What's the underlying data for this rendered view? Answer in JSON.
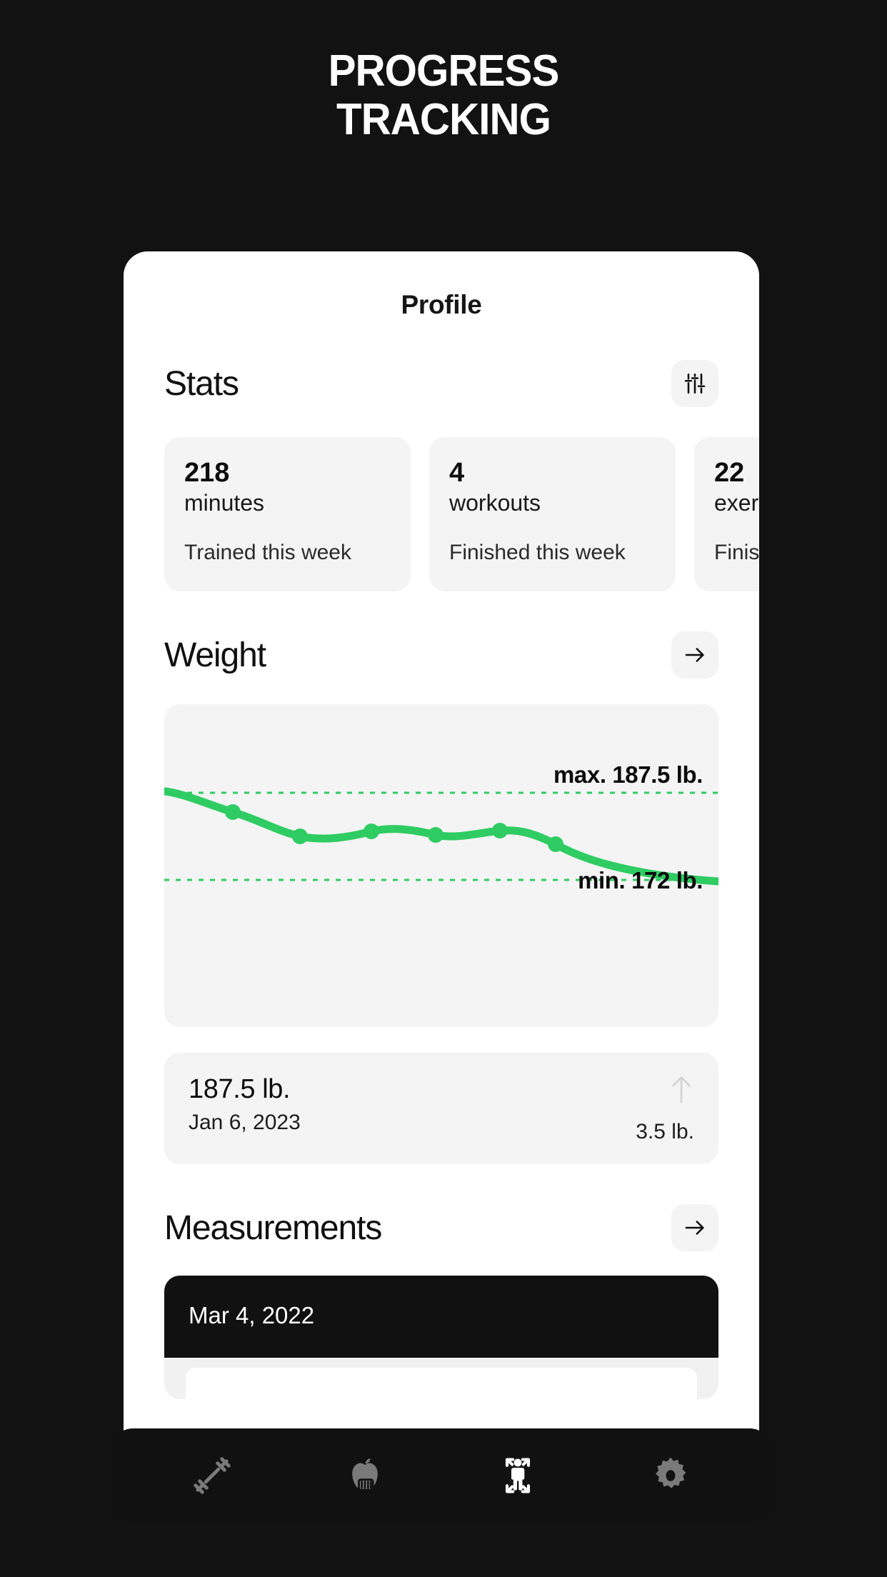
{
  "hero": {
    "line1": "PROGRESS",
    "line2": "TRACKING"
  },
  "phone": {
    "title": "Profile"
  },
  "stats": {
    "heading": "Stats",
    "filter_icon": "sliders-icon",
    "cards": [
      {
        "value": "218",
        "unit": "minutes",
        "desc": "Trained this week"
      },
      {
        "value": "4",
        "unit": "workouts",
        "desc": "Finished this week"
      },
      {
        "value": "22",
        "unit": "exercises",
        "desc": "Finished this week"
      }
    ]
  },
  "weight": {
    "heading": "Weight",
    "arrow_icon": "arrow-right-icon",
    "max_label": "max. 187.5 lb.",
    "min_label": "min. 172 lb.",
    "entry": {
      "value": "187.5 lb.",
      "date": "Jan 6, 2023",
      "delta": "3.5 lb.",
      "trend_icon": "arrow-up-icon"
    }
  },
  "measurements": {
    "heading": "Measurements",
    "arrow_icon": "arrow-right-icon",
    "entry_date": "Mar 4, 2022"
  },
  "nav": {
    "items": [
      {
        "name": "workouts",
        "icon": "dumbbell-icon",
        "active": false
      },
      {
        "name": "nutrition",
        "icon": "apple-tape-icon",
        "active": false
      },
      {
        "name": "body",
        "icon": "body-measure-icon",
        "active": true
      },
      {
        "name": "settings",
        "icon": "gear-icon",
        "active": false
      }
    ]
  },
  "colors": {
    "background": "#121212",
    "card": "#ffffff",
    "tile": "#f4f4f4",
    "accent_green": "#2ecc62",
    "dark": "#111111",
    "text": "#0d0d0d"
  },
  "chart_data": {
    "type": "line",
    "title": "Weight",
    "xlabel": "",
    "ylabel": "lb.",
    "unit": "lb.",
    "series": [
      {
        "name": "Weight",
        "x": [
          0,
          1,
          2,
          3,
          4,
          5,
          6,
          7
        ],
        "values": [
          187.5,
          184.0,
          180.5,
          181.5,
          180.0,
          180.8,
          180.6,
          172.0
        ]
      }
    ],
    "max_line": 187.5,
    "min_line": 172,
    "max_label": "max. 187.5 lb.",
    "min_label": "min. 172 lb.",
    "ylim": [
      170,
      189
    ],
    "grid": false,
    "gridlines": "dotted-min-max",
    "legend": "none",
    "line_color": "#2ecc62",
    "point_count": 7
  }
}
